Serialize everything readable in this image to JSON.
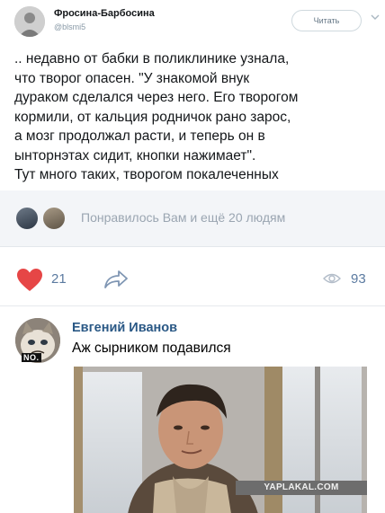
{
  "tweet": {
    "author_name": "Фросина-Барбосина",
    "handle": "@blsmi5",
    "follow_label": "Читать",
    "text": ".. недавно от бабки в поликлинике узнала,\nчто творог опасен. \"У знакомой внук\nдураком сделался через него. Его творогом\nкормили, от кальция родничок рано зарос,\nа мозг продолжал расти, и теперь он в\nынторнэтах сидит, кнопки нажимает\".\nТут много таких, творогом покалеченных"
  },
  "vk_post": {
    "likes_summary": "Понравилось Вам и ещё 20 людям",
    "like_count": "21",
    "views_count": "93",
    "icons": {
      "like": "heart-icon",
      "share": "share-icon",
      "views": "eye-icon"
    },
    "colors": {
      "heart": "#e64646",
      "accent": "#5b7aa0",
      "name": "#2a5885"
    }
  },
  "comment": {
    "author_name": "Евгений Иванов",
    "avatar_caption": "NO.",
    "text": "Аж сырником подавился"
  },
  "watermark": "YAPLAKAL.COM"
}
